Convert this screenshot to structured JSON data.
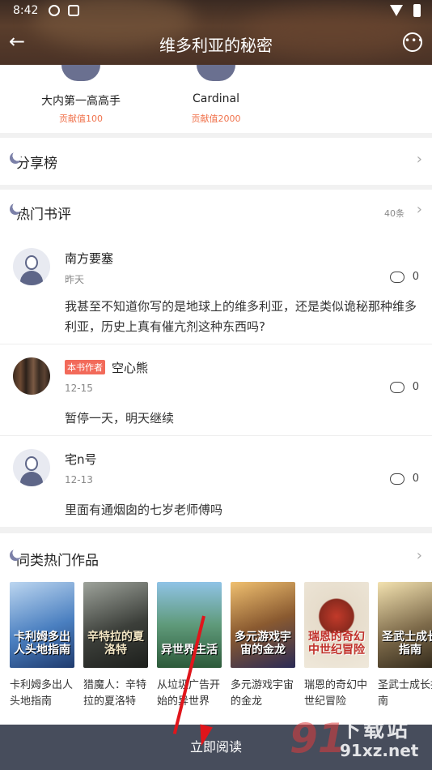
{
  "status_bar": {
    "time": "8:42"
  },
  "header": {
    "title": "维多利亚的秘密"
  },
  "fans": [
    {
      "name": "大内第一高高手",
      "contribution": "贡献值100"
    },
    {
      "name": "Cardinal",
      "contribution": "贡献值2000"
    }
  ],
  "share_section": {
    "title": "分享榜"
  },
  "reviews_section": {
    "title": "热门书评",
    "count": "40条",
    "reviews": [
      {
        "name": "南方要塞",
        "date": "昨天",
        "comments": "0",
        "text": "我甚至不知道你写的是地球上的维多利亚，还是类似诡秘那种维多利亚，历史上真有催亢剂这种东西吗?"
      },
      {
        "badge": "本书作者",
        "name": "空心熊",
        "date": "12-15",
        "comments": "0",
        "text": "暂停一天，明天继续"
      },
      {
        "name": "宅n号",
        "date": "12-13",
        "comments": "0",
        "text": "里面有通烟囱的七岁老师傅吗"
      }
    ]
  },
  "similar_section": {
    "title": "同类热门作品",
    "books": [
      {
        "title": "卡利姆多出人头地指南",
        "cover_text": "卡利姆多出人头地指南",
        "color": "#4a7fc0"
      },
      {
        "title": "猎魔人：辛特拉的夏洛特",
        "cover_text": "辛特拉的夏洛特",
        "color": "#3c3f3a"
      },
      {
        "title": "从垃圾广告开始的异世界",
        "cover_text": "异世界生活",
        "color": "#5f9a7a"
      },
      {
        "title": "多元游戏宇宙的金龙",
        "cover_text": "多元游戏宇宙的金龙",
        "color": "#8a5a30"
      },
      {
        "title": "瑞恩的奇幻中世纪冒险",
        "cover_text": "瑞恩的奇幻中世纪冒险",
        "color": "#e6dccb"
      },
      {
        "title": "圣武士成长指南",
        "cover_text": "圣武士成长指南",
        "color": "#7d6a4a"
      }
    ]
  },
  "read_button": {
    "label": "立即阅读"
  },
  "watermark": {
    "top": "下载站",
    "bottom": "91xz.net"
  }
}
